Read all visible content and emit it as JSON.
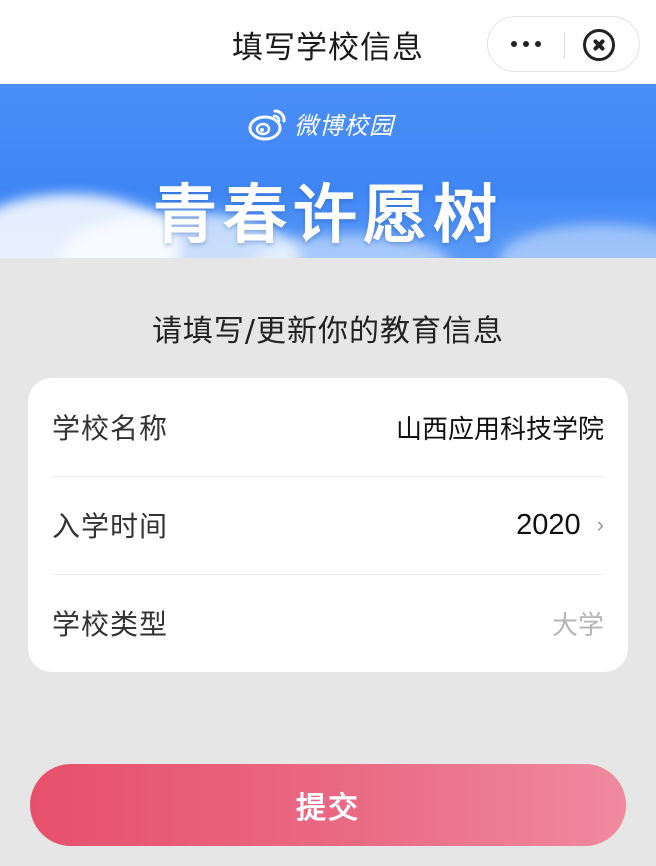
{
  "nav": {
    "title": "填写学校信息",
    "more_icon": "more-dots-icon",
    "close_icon": "close-circle-icon"
  },
  "banner": {
    "brand_text": "微博校园",
    "brand_icon": "weibo-logo-icon",
    "title": "青春许愿树",
    "colors": {
      "top": "#4b8ef7",
      "bottom": "#5a9af7"
    }
  },
  "section": {
    "heading": "请填写/更新你的教育信息"
  },
  "form": {
    "rows": [
      {
        "label": "学校名称",
        "value": "山西应用科技学院"
      },
      {
        "label": "入学时间",
        "value": "2020",
        "chevron_icon": "chevron-right-icon"
      },
      {
        "label": "学校类型",
        "value": "大学"
      }
    ]
  },
  "submit": {
    "label": "提交",
    "color": "#e7506b"
  }
}
